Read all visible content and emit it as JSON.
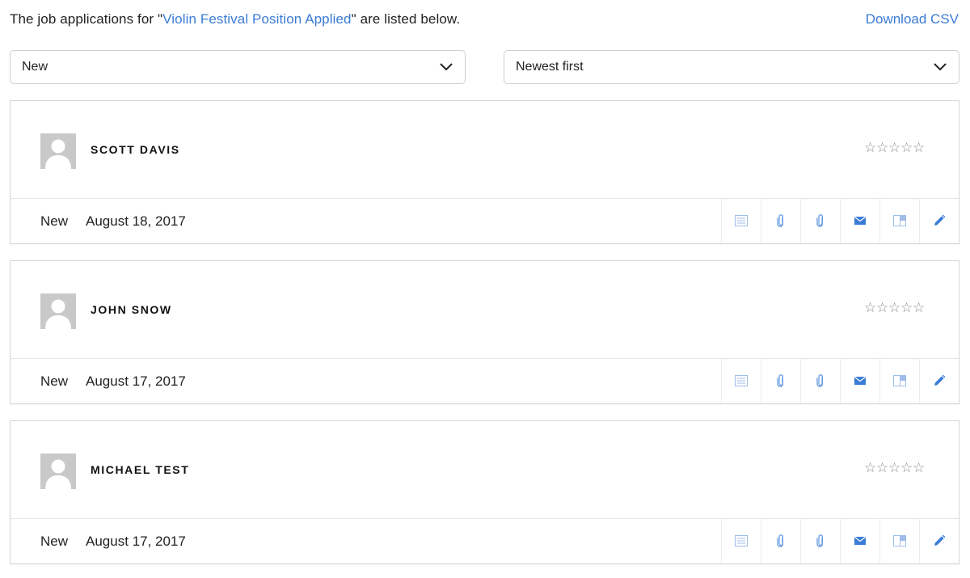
{
  "header": {
    "intro_prefix": "The job applications for \"",
    "job_title": "Violin Festival Position Applied",
    "intro_suffix": "\" are listed below.",
    "download_label": "Download CSV"
  },
  "filters": {
    "status_value": "New",
    "sort_value": "Newest first"
  },
  "applications": [
    {
      "name": "SCOTT DAVIS",
      "status": "New",
      "date": "August 18, 2017",
      "rating": 0
    },
    {
      "name": "JOHN SNOW",
      "status": "New",
      "date": "August 17, 2017",
      "rating": 0
    },
    {
      "name": "MICHAEL TEST",
      "status": "New",
      "date": "August 17, 2017",
      "rating": 0
    }
  ],
  "star_glyph": "☆",
  "action_icons": [
    "list-icon",
    "attachment-icon",
    "attachment-icon",
    "envelope-icon",
    "layout-icon",
    "pencil-icon"
  ],
  "colors": {
    "accent": "#3a7bd5",
    "icon_light": "#9fbde8",
    "avatar_bg": "#c9c9c9"
  }
}
